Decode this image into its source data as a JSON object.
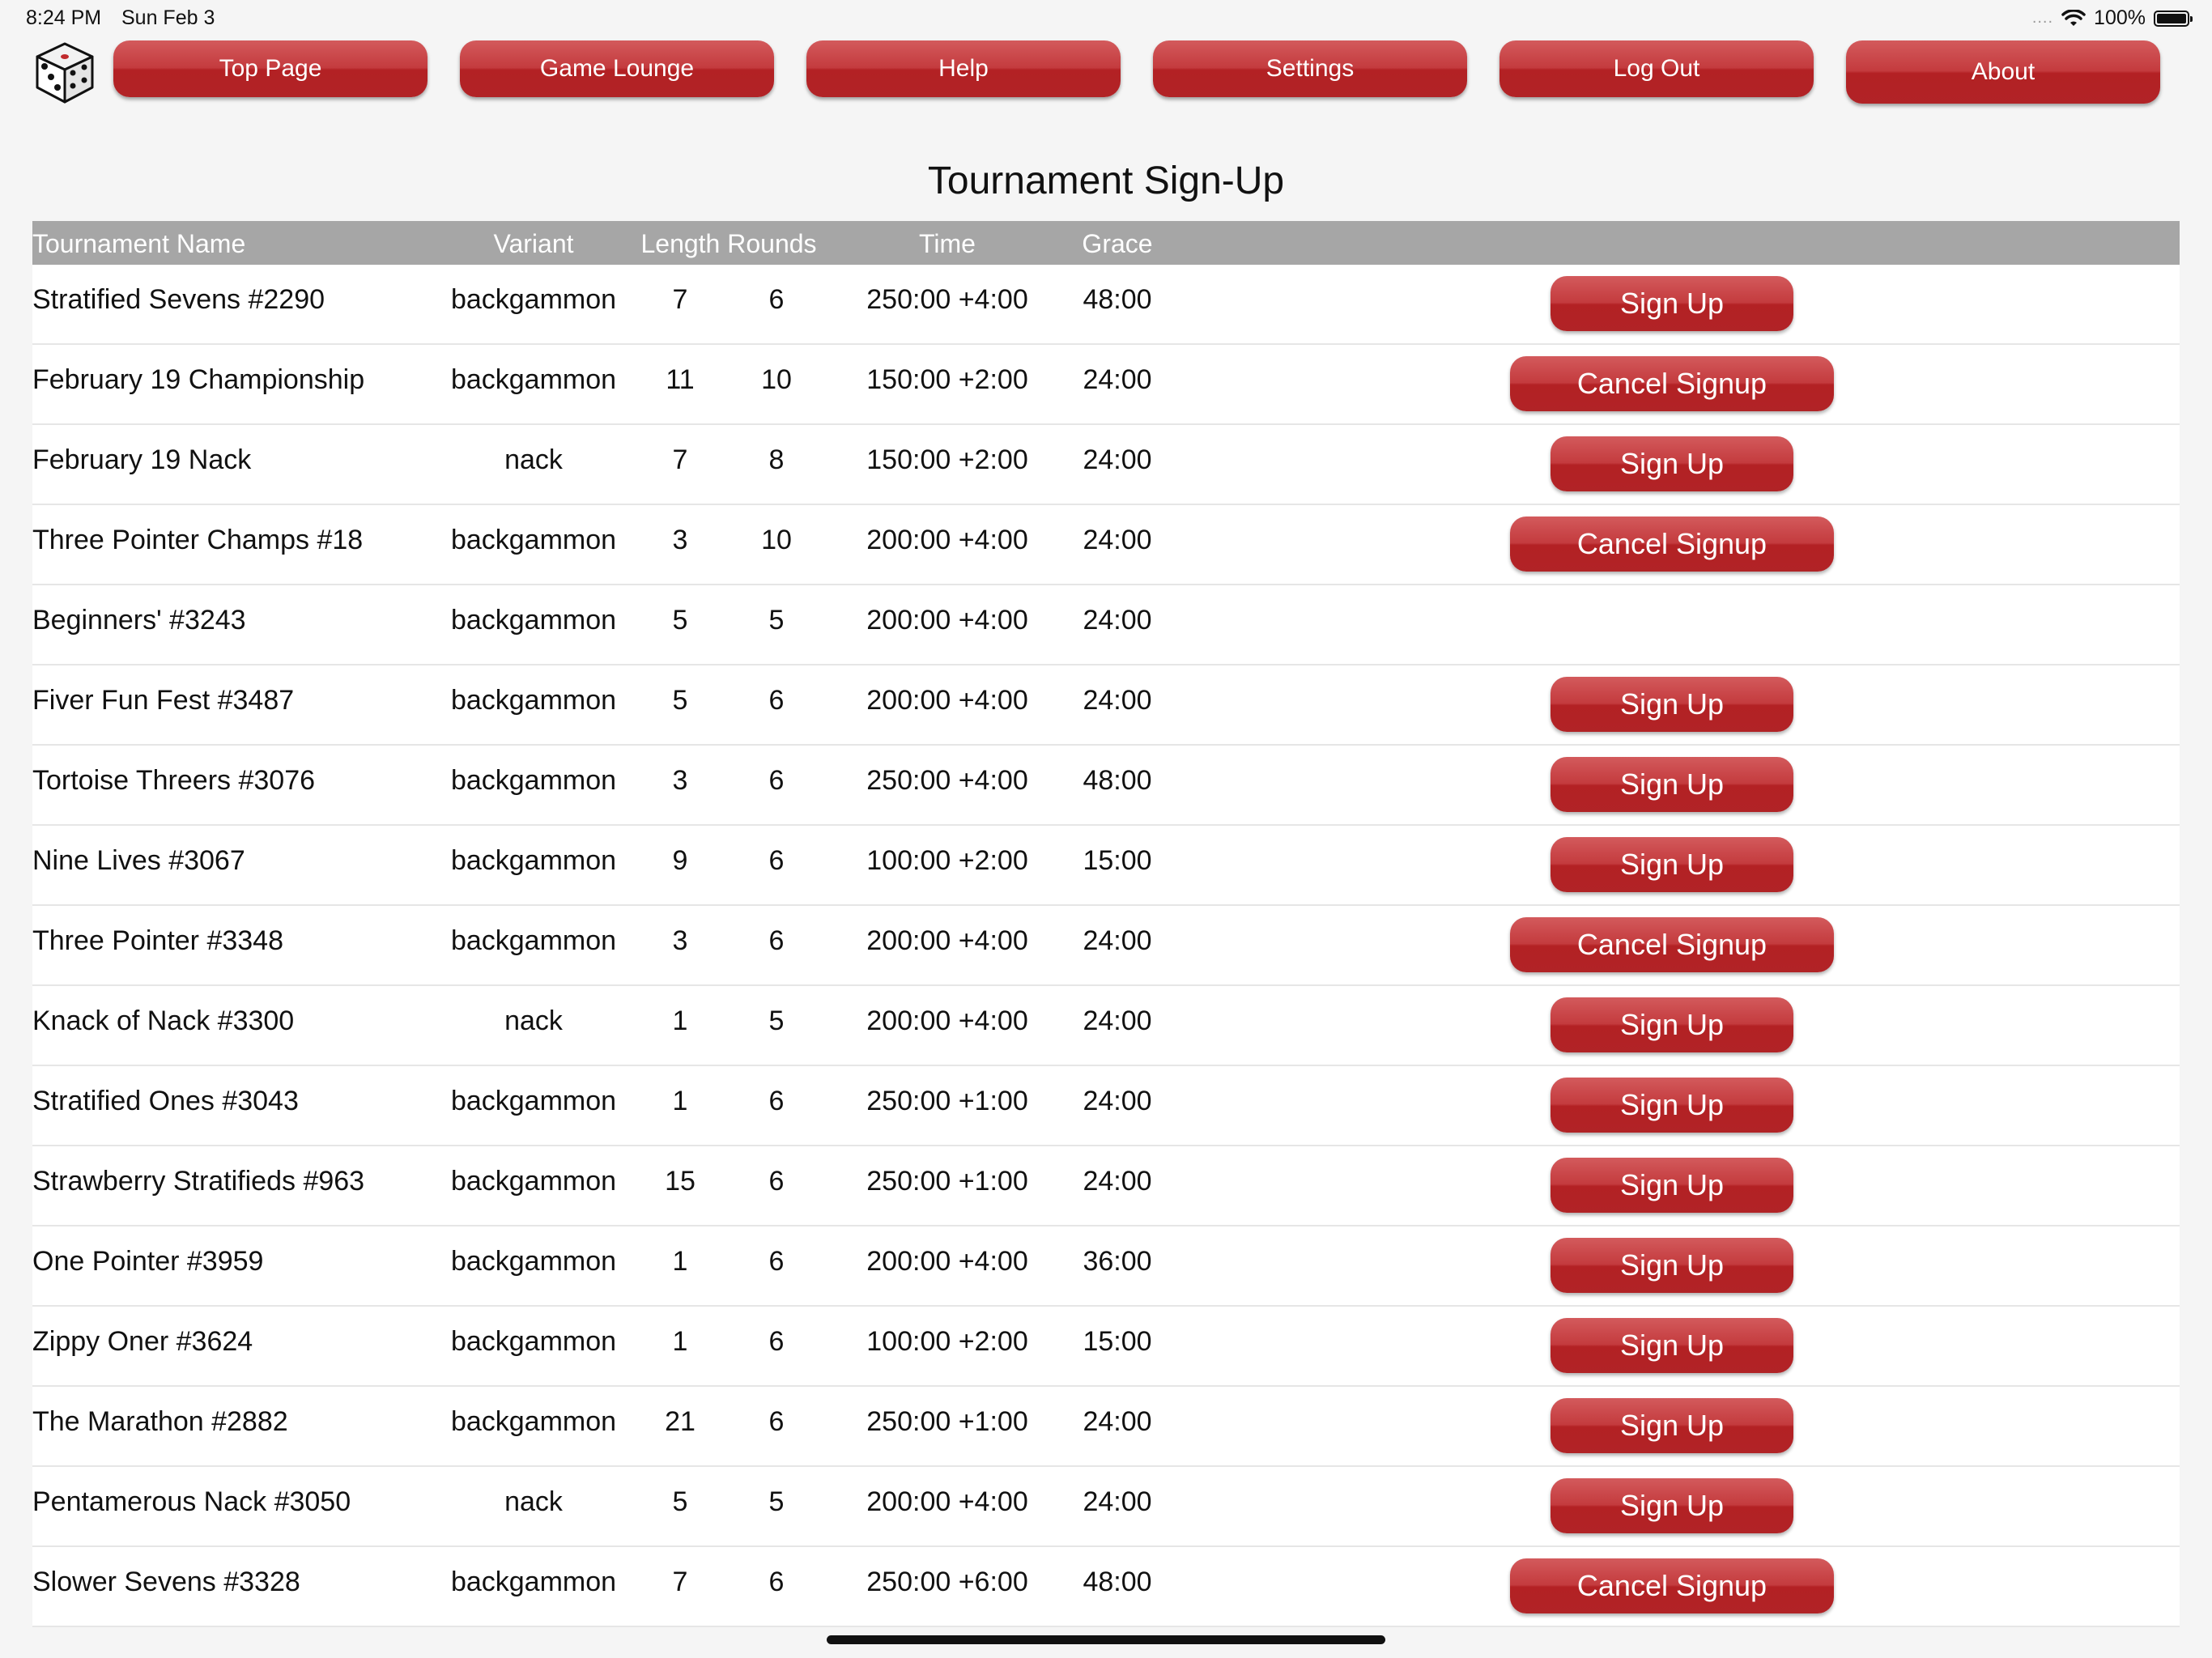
{
  "status_bar": {
    "time": "8:24 PM",
    "date": "Sun Feb 3",
    "signal_dots": "....",
    "wifi_icon": "wifi-icon",
    "battery_percent": "100%",
    "battery_icon": "battery-full-icon"
  },
  "logo_icon": "dice-icon",
  "nav": {
    "top_page": "Top Page",
    "game_lounge": "Game Lounge",
    "help": "Help",
    "settings": "Settings",
    "log_out": "Log Out",
    "about": "About"
  },
  "page_title": "Tournament Sign-Up",
  "table": {
    "headers": {
      "name": "Tournament Name",
      "variant": "Variant",
      "length_rounds": "Length Rounds",
      "time": "Time",
      "grace": "Grace"
    },
    "rows": [
      {
        "name": "Stratified Sevens #2290",
        "variant": "backgammon",
        "length": "7",
        "rounds": "6",
        "time": "250:00 +4:00",
        "grace": "48:00",
        "action": "Sign Up"
      },
      {
        "name": "February 19 Championship",
        "variant": "backgammon",
        "length": "11",
        "rounds": "10",
        "time": "150:00 +2:00",
        "grace": "24:00",
        "action": "Cancel Signup"
      },
      {
        "name": "February 19 Nack",
        "variant": "nack",
        "length": "7",
        "rounds": "8",
        "time": "150:00 +2:00",
        "grace": "24:00",
        "action": "Sign Up"
      },
      {
        "name": "Three Pointer Champs #18",
        "variant": "backgammon",
        "length": "3",
        "rounds": "10",
        "time": "200:00 +4:00",
        "grace": "24:00",
        "action": "Cancel Signup"
      },
      {
        "name": "Beginners' #3243",
        "variant": "backgammon",
        "length": "5",
        "rounds": "5",
        "time": "200:00 +4:00",
        "grace": "24:00",
        "action": ""
      },
      {
        "name": "Fiver Fun Fest #3487",
        "variant": "backgammon",
        "length": "5",
        "rounds": "6",
        "time": "200:00 +4:00",
        "grace": "24:00",
        "action": "Sign Up"
      },
      {
        "name": "Tortoise Threers #3076",
        "variant": "backgammon",
        "length": "3",
        "rounds": "6",
        "time": "250:00 +4:00",
        "grace": "48:00",
        "action": "Sign Up"
      },
      {
        "name": "Nine Lives #3067",
        "variant": "backgammon",
        "length": "9",
        "rounds": "6",
        "time": "100:00 +2:00",
        "grace": "15:00",
        "action": "Sign Up"
      },
      {
        "name": "Three Pointer #3348",
        "variant": "backgammon",
        "length": "3",
        "rounds": "6",
        "time": "200:00 +4:00",
        "grace": "24:00",
        "action": "Cancel Signup"
      },
      {
        "name": "Knack of Nack #3300",
        "variant": "nack",
        "length": "1",
        "rounds": "5",
        "time": "200:00 +4:00",
        "grace": "24:00",
        "action": "Sign Up"
      },
      {
        "name": "Stratified Ones #3043",
        "variant": "backgammon",
        "length": "1",
        "rounds": "6",
        "time": "250:00 +1:00",
        "grace": "24:00",
        "action": "Sign Up"
      },
      {
        "name": "Strawberry Stratifieds #963",
        "variant": "backgammon",
        "length": "15",
        "rounds": "6",
        "time": "250:00 +1:00",
        "grace": "24:00",
        "action": "Sign Up"
      },
      {
        "name": "One Pointer #3959",
        "variant": "backgammon",
        "length": "1",
        "rounds": "6",
        "time": "200:00 +4:00",
        "grace": "36:00",
        "action": "Sign Up"
      },
      {
        "name": "Zippy Oner #3624",
        "variant": "backgammon",
        "length": "1",
        "rounds": "6",
        "time": "100:00 +2:00",
        "grace": "15:00",
        "action": "Sign Up"
      },
      {
        "name": "The Marathon #2882",
        "variant": "backgammon",
        "length": "21",
        "rounds": "6",
        "time": "250:00 +1:00",
        "grace": "24:00",
        "action": "Sign Up"
      },
      {
        "name": "Pentamerous Nack #3050",
        "variant": "nack",
        "length": "5",
        "rounds": "5",
        "time": "200:00 +4:00",
        "grace": "24:00",
        "action": "Sign Up"
      },
      {
        "name": "Slower Sevens #3328",
        "variant": "backgammon",
        "length": "7",
        "rounds": "6",
        "time": "250:00 +6:00",
        "grace": "48:00",
        "action": "Cancel Signup"
      }
    ]
  },
  "colors": {
    "button_red": "#c0292c",
    "header_gray": "#a6a6a6",
    "page_bg": "#f5f5f5"
  }
}
